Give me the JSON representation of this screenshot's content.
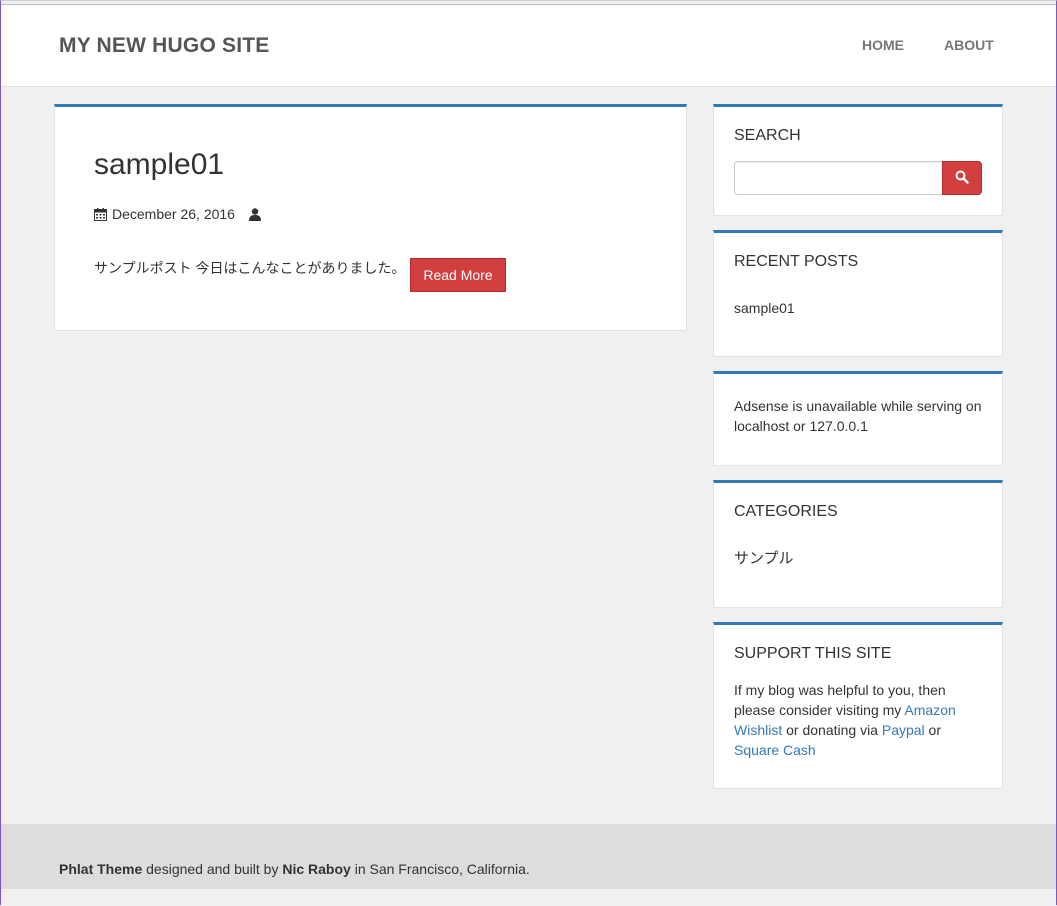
{
  "header": {
    "site_title": "MY NEW HUGO SITE",
    "nav": [
      {
        "label": "HOME"
      },
      {
        "label": "ABOUT"
      }
    ]
  },
  "post": {
    "title": "sample01",
    "date": "December 26, 2016",
    "excerpt": "サンプルポスト 今日はこんなことがありました。",
    "read_more_label": "Read More",
    "icons": [
      "calendar-icon",
      "user-icon"
    ]
  },
  "sidebar": {
    "search": {
      "title": "SEARCH",
      "input_value": "",
      "button_icon": "search-icon"
    },
    "recent_posts": {
      "title": "RECENT POSTS",
      "items": [
        "sample01"
      ]
    },
    "adsense": {
      "text": "Adsense is unavailable while serving on localhost or 127.0.0.1"
    },
    "categories": {
      "title": "CATEGORIES",
      "items": [
        "サンプル"
      ]
    },
    "support": {
      "title": "SUPPORT THIS SITE",
      "text_1": "If my blog was helpful to you, then please consider visiting my ",
      "link_amazon": "Amazon Wishlist",
      "text_2": " or donating via ",
      "link_paypal": "Paypal",
      "text_3": " or ",
      "link_square": "Square Cash"
    }
  },
  "footer": {
    "theme_name": "Phlat Theme",
    "text_1": " designed and built by ",
    "author": "Nic Raboy",
    "text_2": " in San Francisco, California."
  },
  "colors": {
    "accent_blue": "#337ab7",
    "button_red": "#d13f3f",
    "background": "#f0f0f0",
    "footer_bg": "#dddddd"
  }
}
